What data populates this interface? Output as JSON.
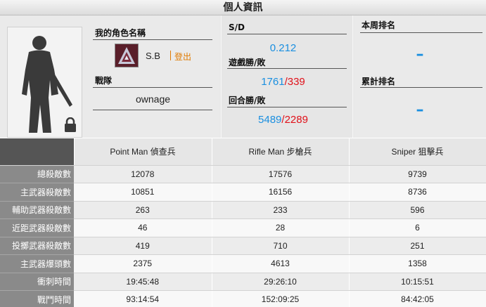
{
  "header": {
    "title": "個人資訊"
  },
  "profile": {
    "character_label": "我的角色名稱",
    "player_name": "S.B",
    "logout_label": "登出",
    "clan_label": "戰隊",
    "clan_name": "ownage",
    "emblem_icon": "clan-emblem-icon",
    "avatar_icon": "soldier-silhouette-icon",
    "lock_icon": "lock-icon"
  },
  "stats": {
    "sd_label": "S/D",
    "sd_value": "0.212",
    "game_wl_label": "遊戲勝/敗",
    "game_wins": "1761",
    "game_losses": "339",
    "round_wl_label": "回合勝/敗",
    "round_wins": "5489",
    "round_losses": "2289",
    "separator": "/"
  },
  "ranking": {
    "weekly_label": "本周排名",
    "weekly_value": "–",
    "total_label": "累計排名",
    "total_value": "–"
  },
  "table": {
    "columns": [
      "Point Man 偵查兵",
      "Rifle Man 步槍兵",
      "Sniper 狙擊兵"
    ],
    "rows": [
      {
        "label": "總殺敵數",
        "values": [
          "12078",
          "17576",
          "9739"
        ]
      },
      {
        "label": "主武器殺敵數",
        "values": [
          "10851",
          "16156",
          "8736"
        ]
      },
      {
        "label": "輔助武器殺敵數",
        "values": [
          "263",
          "233",
          "596"
        ]
      },
      {
        "label": "近距武器殺敵數",
        "values": [
          "46",
          "28",
          "6"
        ]
      },
      {
        "label": "投擲武器殺敵數",
        "values": [
          "419",
          "710",
          "251"
        ]
      },
      {
        "label": "主武器爆頭數",
        "values": [
          "2375",
          "4613",
          "1358"
        ]
      },
      {
        "label": "衝刺時間",
        "values": [
          "19:45:48",
          "29:26:10",
          "10:15:51"
        ]
      },
      {
        "label": "戰鬥時間",
        "values": [
          "93:14:54",
          "152:09:25",
          "84:42:05"
        ]
      }
    ]
  },
  "colors": {
    "accent_blue": "#1a8fe0",
    "loss_red": "#e0111a",
    "logout_orange": "#e07a00"
  }
}
